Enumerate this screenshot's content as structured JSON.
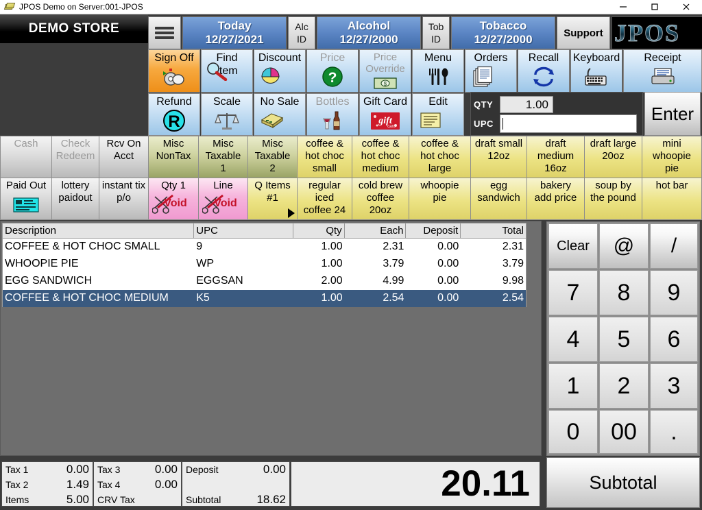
{
  "window": {
    "title": "JPOS Demo on Server:001-JPOS",
    "minimize": "—",
    "maximize": "☐",
    "close": "✕"
  },
  "store": {
    "name": "DEMO STORE"
  },
  "header": {
    "menu_icon": "hamburger-menu-icon",
    "today": {
      "line1": "Today",
      "line2": "12/27/2021"
    },
    "alc_id": {
      "line1": "Alc",
      "line2": "ID"
    },
    "alcohol": {
      "line1": "Alcohol",
      "line2": "12/27/2000"
    },
    "tob_id": {
      "line1": "Tob",
      "line2": "ID"
    },
    "tobacco": {
      "line1": "Tobacco",
      "line2": "12/27/2000"
    },
    "support": "Support",
    "logo": "JPOS"
  },
  "function_buttons": [
    {
      "label": "Sign Off",
      "icon": "sign-off-icon",
      "style": "orange",
      "enabled": true
    },
    {
      "label": "Find\nItem",
      "icon": "magnifier-icon",
      "style": "blue",
      "enabled": true
    },
    {
      "label": "Discount",
      "icon": "discount-pie-icon",
      "style": "blue",
      "enabled": true
    },
    {
      "label": "Price",
      "icon": "question-mark-icon",
      "style": "blue",
      "enabled": false
    },
    {
      "label": "Price\nOverride",
      "icon": "money-bill-icon",
      "style": "blue",
      "enabled": false
    },
    {
      "label": "Menu",
      "icon": "cutlery-icon",
      "style": "blue",
      "enabled": true
    },
    {
      "label": "Orders",
      "icon": "documents-icon",
      "style": "blue",
      "enabled": true
    },
    {
      "label": "Recall",
      "icon": "refresh-arrows-icon",
      "style": "blue",
      "enabled": true
    },
    {
      "label": "Keyboard",
      "icon": "keyboard-icon",
      "style": "blue",
      "enabled": true
    },
    {
      "label": "Receipt",
      "icon": "printer-icon",
      "style": "blue",
      "enabled": true
    },
    {
      "label": "Refund",
      "icon": "refund-r-icon",
      "style": "blue",
      "enabled": true
    },
    {
      "label": "Scale",
      "icon": "scale-balance-icon",
      "style": "blue",
      "enabled": true
    },
    {
      "label": "No Sale",
      "icon": "cash-drawer-icon",
      "style": "blue",
      "enabled": true
    },
    {
      "label": "Bottles",
      "icon": "bottle-glass-icon",
      "style": "blue",
      "enabled": false
    },
    {
      "label": "Gift Card",
      "icon": "gift-card-icon",
      "style": "blue",
      "enabled": true
    },
    {
      "label": "Edit",
      "icon": "edit-lines-icon",
      "style": "blue",
      "enabled": true
    }
  ],
  "entry": {
    "qty_label": "QTY",
    "qty_value": "1.00",
    "upc_label": "UPC",
    "upc_value": "",
    "enter_label": "Enter"
  },
  "dept_keys_row1": [
    {
      "label": "Cash",
      "style": "k-gray",
      "enabled": false
    },
    {
      "label": "Check\nRedeem",
      "style": "k-gray",
      "enabled": false
    },
    {
      "label": "Rcv On\nAcct",
      "style": "k-gray",
      "enabled": true
    },
    {
      "label": "Misc\nNonTax",
      "style": "k-olive",
      "enabled": true
    },
    {
      "label": "Misc\nTaxable\n1",
      "style": "k-olive",
      "enabled": true
    },
    {
      "label": "Misc\nTaxable\n2",
      "style": "k-olive",
      "enabled": true
    },
    {
      "label": "coffee &\nhot choc\nsmall",
      "style": "k-yellow",
      "enabled": true
    },
    {
      "label": "coffee &\nhot choc\nmedium",
      "style": "k-yellow",
      "enabled": true
    },
    {
      "label": "coffee &\nhot choc\nlarge",
      "style": "k-yellow",
      "enabled": true
    },
    {
      "label": "draft small\n12oz",
      "style": "k-yellow",
      "enabled": true
    },
    {
      "label": "draft\nmedium\n16oz",
      "style": "k-yellow",
      "enabled": true
    },
    {
      "label": "draft large\n20oz",
      "style": "k-yellow",
      "enabled": true
    },
    {
      "label": "mini\nwhoopie\npie",
      "style": "k-yellow",
      "enabled": true
    }
  ],
  "dept_keys_row2": [
    {
      "label": "Paid Out",
      "style": "k-gray",
      "enabled": true,
      "icon": "cash-drawer-icon"
    },
    {
      "label": "lottery\npaidout",
      "style": "k-gray",
      "enabled": true
    },
    {
      "label": "instant tix\np/o",
      "style": "k-gray",
      "enabled": true
    },
    {
      "label": "Qty 1",
      "style": "k-pink",
      "enabled": true,
      "icon": "void-scissors-icon",
      "sub": "Void"
    },
    {
      "label": "Line",
      "style": "k-pink",
      "enabled": true,
      "icon": "void-scissors-icon",
      "sub": "Void"
    },
    {
      "label": "Q Items\n#1",
      "style": "k-yellow",
      "enabled": true,
      "arrow": true
    },
    {
      "label": "regular\niced\ncoffee 24",
      "style": "k-yellow",
      "enabled": true
    },
    {
      "label": "cold brew\ncoffee\n20oz",
      "style": "k-yellow",
      "enabled": true
    },
    {
      "label": "whoopie\npie",
      "style": "k-yellow",
      "enabled": true
    },
    {
      "label": "egg\nsandwich",
      "style": "k-yellow",
      "enabled": true
    },
    {
      "label": "bakery\nadd price",
      "style": "k-yellow",
      "enabled": true
    },
    {
      "label": "soup by\nthe pound",
      "style": "k-yellow",
      "enabled": true
    },
    {
      "label": "hot bar",
      "style": "k-yellow",
      "enabled": true
    }
  ],
  "receipt": {
    "columns": [
      "Description",
      "UPC",
      "Qty",
      "Each",
      "Deposit",
      "Total"
    ],
    "rows": [
      {
        "description": "COFFEE & HOT CHOC SMALL",
        "upc": "9",
        "qty": "1.00",
        "each": "2.31",
        "deposit": "0.00",
        "total": "2.31",
        "selected": false
      },
      {
        "description": "WHOOPIE PIE",
        "upc": "WP",
        "qty": "1.00",
        "each": "3.79",
        "deposit": "0.00",
        "total": "3.79",
        "selected": false
      },
      {
        "description": "EGG SANDWICH",
        "upc": "EGGSAN",
        "qty": "2.00",
        "each": "4.99",
        "deposit": "0.00",
        "total": "9.98",
        "selected": false
      },
      {
        "description": "COFFEE & HOT CHOC MEDIUM",
        "upc": "K5",
        "qty": "1.00",
        "each": "2.54",
        "deposit": "0.00",
        "total": "2.54",
        "selected": true
      }
    ]
  },
  "keypad": [
    {
      "label": "Clear",
      "name": "clear",
      "size": "sm",
      "top": true
    },
    {
      "label": "@",
      "name": "at",
      "size": "md",
      "top": true
    },
    {
      "label": "/",
      "name": "slash",
      "size": "md",
      "top": true
    },
    {
      "label": "7",
      "name": "7",
      "size": "lg"
    },
    {
      "label": "8",
      "name": "8",
      "size": "lg"
    },
    {
      "label": "9",
      "name": "9",
      "size": "lg"
    },
    {
      "label": "4",
      "name": "4",
      "size": "lg"
    },
    {
      "label": "5",
      "name": "5",
      "size": "lg"
    },
    {
      "label": "6",
      "name": "6",
      "size": "lg"
    },
    {
      "label": "1",
      "name": "1",
      "size": "lg"
    },
    {
      "label": "2",
      "name": "2",
      "size": "lg"
    },
    {
      "label": "3",
      "name": "3",
      "size": "lg"
    },
    {
      "label": "0",
      "name": "0",
      "size": "lg"
    },
    {
      "label": "00",
      "name": "double-zero",
      "size": "lg"
    },
    {
      "label": ".",
      "name": "decimal",
      "size": "lg"
    }
  ],
  "totals": {
    "tax1_label": "Tax 1",
    "tax1_value": "0.00",
    "tax2_label": "Tax 2",
    "tax2_value": "1.49",
    "items_label": "Items",
    "items_value": "5.00",
    "tax3_label": "Tax 3",
    "tax3_value": "0.00",
    "tax4_label": "Tax 4",
    "tax4_value": "0.00",
    "crv_label": "CRV Tax",
    "crv_value": "",
    "deposit_label": "Deposit",
    "deposit_value": "0.00",
    "subtotal_label": "Subtotal",
    "subtotal_value": "18.62",
    "grand_total": "20.11"
  },
  "subtotal_button": {
    "label": "Subtotal"
  },
  "colors": {
    "blue_key": "#9cc6e8",
    "orange_key": "#f7a93f",
    "yellow_key": "#ece384",
    "olive_key": "#cfd3a0",
    "pink_key": "#f6b4dc",
    "selected_row": "#3a5a80",
    "header_blue": "#5b85c4",
    "dark_chrome": "#3c3c3c"
  }
}
